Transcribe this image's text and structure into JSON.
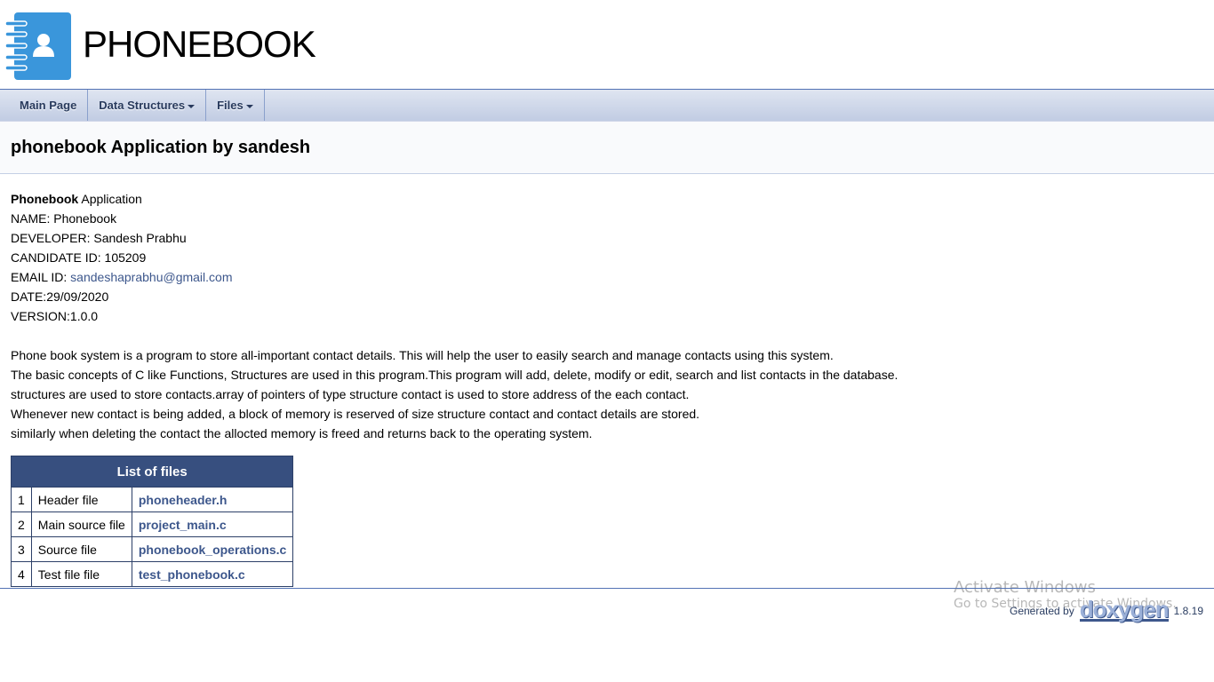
{
  "title": "PHONEBOOK",
  "nav": [
    {
      "label": "Main Page",
      "dropdown": false
    },
    {
      "label": "Data Structures",
      "dropdown": true
    },
    {
      "label": "Files",
      "dropdown": true
    }
  ],
  "header": "phonebook Application by sandesh",
  "info": {
    "bold": "Phonebook",
    "rest": " Application",
    "name": "NAME: Phonebook",
    "developer": "DEVELOPER: Sandesh Prabhu",
    "candidate": "CANDIDATE ID: 105209",
    "email_label": "EMAIL ID: ",
    "email": "sandeshaprabhu@gmail.com",
    "date": "DATE:29/09/2020",
    "version": "VERSION:1.0.0"
  },
  "description": [
    "Phone book system is a program to store all-important contact details. This will help the user to easily search and manage contacts using this system.",
    "The basic concepts of C like Functions, Structures are used in this program.This program will add, delete, modify or edit, search and list contacts in the database.",
    "structures are used to store contacts.array of pointers of type structure contact is used to store address of the each contact.",
    "Whenever new contact is being added, a block of memory is reserved of size structure contact and contact details are stored.",
    "similarly when deleting the contact the allocted memory is freed and returns back to the operating system."
  ],
  "table": {
    "title": "List of files",
    "rows": [
      [
        "1",
        "Header file",
        "phoneheader.h"
      ],
      [
        "2",
        "Main source file",
        "project_main.c"
      ],
      [
        "3",
        "Source file",
        "phonebook_operations.c"
      ],
      [
        "4",
        "Test file file",
        "test_phonebook.c"
      ]
    ]
  },
  "footer": {
    "generated": "Generated by",
    "brand": "doxygen",
    "version": "1.8.19"
  },
  "watermark": {
    "line1": "Activate Windows",
    "line2": "Go to Settings to activate Windows."
  }
}
